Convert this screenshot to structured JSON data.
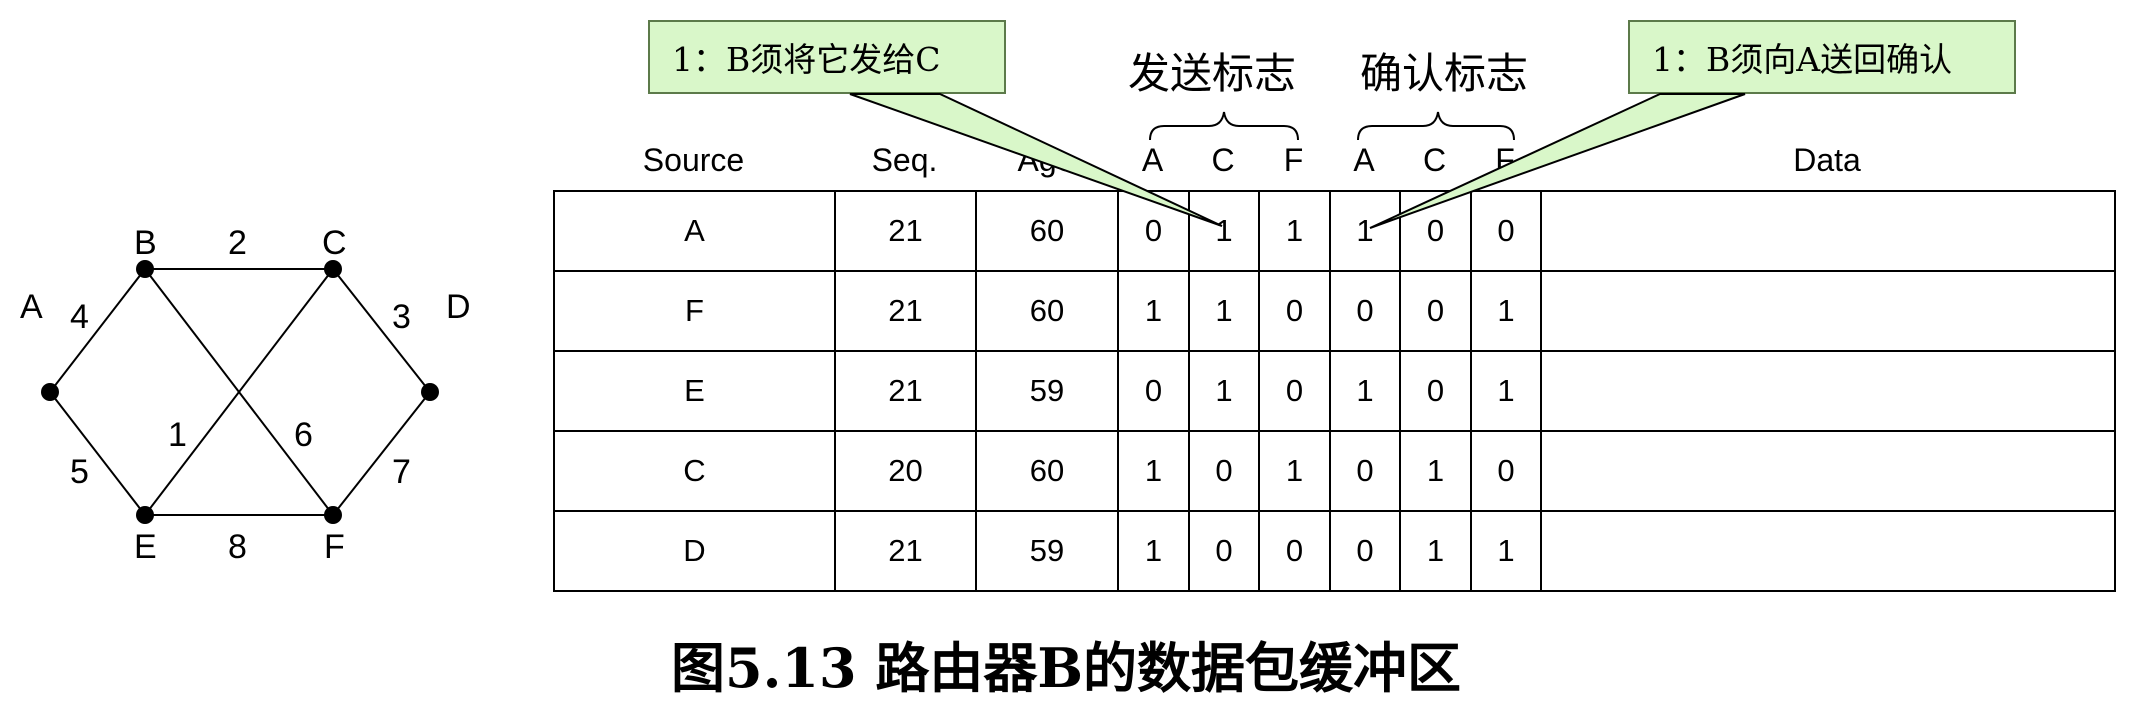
{
  "graph": {
    "nodes": [
      {
        "id": "A",
        "label": "A"
      },
      {
        "id": "B",
        "label": "B"
      },
      {
        "id": "C",
        "label": "C"
      },
      {
        "id": "D",
        "label": "D"
      },
      {
        "id": "E",
        "label": "E"
      },
      {
        "id": "F",
        "label": "F"
      }
    ],
    "edges": [
      {
        "from": "B",
        "to": "C",
        "weight": "2"
      },
      {
        "from": "A",
        "to": "B",
        "weight": "4"
      },
      {
        "from": "C",
        "to": "D",
        "weight": "3"
      },
      {
        "from": "A",
        "to": "E",
        "weight": "5"
      },
      {
        "from": "E",
        "to": "C",
        "weight": "1"
      },
      {
        "from": "B",
        "to": "F",
        "weight": "6"
      },
      {
        "from": "D",
        "to": "F",
        "weight": "7"
      },
      {
        "from": "E",
        "to": "F",
        "weight": "8"
      }
    ]
  },
  "callouts": {
    "left": "1：B须将它发给C",
    "right": "1：B须向A送回确认"
  },
  "groups": {
    "send_flags": "发送标志",
    "ack_flags": "确认标志"
  },
  "table": {
    "headers": [
      "Source",
      "Seq.",
      "Age",
      "A",
      "C",
      "F",
      "A",
      "C",
      "F",
      "Data"
    ],
    "rows": [
      [
        "A",
        "21",
        "60",
        "0",
        "1",
        "1",
        "1",
        "0",
        "0",
        ""
      ],
      [
        "F",
        "21",
        "60",
        "1",
        "1",
        "0",
        "0",
        "0",
        "1",
        ""
      ],
      [
        "E",
        "21",
        "59",
        "0",
        "1",
        "0",
        "1",
        "0",
        "1",
        ""
      ],
      [
        "C",
        "20",
        "60",
        "1",
        "0",
        "1",
        "0",
        "1",
        "0",
        ""
      ],
      [
        "D",
        "21",
        "59",
        "1",
        "0",
        "0",
        "0",
        "1",
        "1",
        ""
      ]
    ]
  },
  "caption": "图5.13 路由器B的数据包缓冲区",
  "colors": {
    "callout_fill": "#d9f7c9",
    "callout_border": "#5c7a4a"
  }
}
